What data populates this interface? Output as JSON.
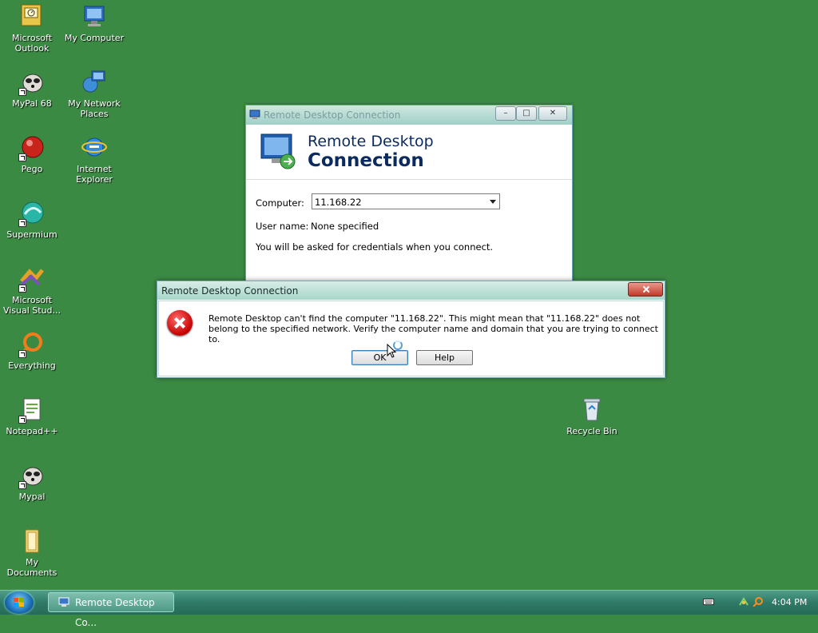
{
  "desktop": {
    "icons": [
      {
        "label": "Microsoft Outlook",
        "icon": "outlook-icon"
      },
      {
        "label": "My Computer",
        "icon": "computer-icon"
      },
      {
        "label": "MyPal 68",
        "icon": "mypal-icon"
      },
      {
        "label": "My Network Places",
        "icon": "network-places-icon"
      },
      {
        "label": "Pego",
        "icon": "pego-icon"
      },
      {
        "label": "Internet Explorer",
        "icon": "internet-explorer-icon"
      },
      {
        "label": "Supermium",
        "icon": "supermium-icon"
      },
      {
        "label": "Microsoft Visual Stud...",
        "icon": "visual-studio-icon"
      },
      {
        "label": "Everything",
        "icon": "everything-search-icon"
      },
      {
        "label": "Notepad++",
        "icon": "notepadpp-icon"
      },
      {
        "label": "Mypal",
        "icon": "mypal-icon"
      },
      {
        "label": "My Documents",
        "icon": "folder-icon"
      },
      {
        "label": "Recycle Bin",
        "icon": "recycle-bin-icon"
      }
    ]
  },
  "rdc_window": {
    "title": "Remote Desktop Connection",
    "header_line1": "Remote Desktop",
    "header_line2": "Connection",
    "computer_label": "Computer:",
    "computer_value": "11.168.22",
    "username_label": "User name:",
    "username_value": "None specified",
    "credentials_note": "You will be asked for credentials when you connect."
  },
  "error_dialog": {
    "title": "Remote Desktop Connection",
    "message": "Remote Desktop can't find the computer \"11.168.22\". This might mean that \"11.168.22\" does not belong to the specified network.  Verify the computer name and domain that you are trying to connect to.",
    "ok_label": "OK",
    "help_label": "Help"
  },
  "taskbar": {
    "task_label": "Remote Desktop Co...",
    "clock": "4:04 PM"
  }
}
